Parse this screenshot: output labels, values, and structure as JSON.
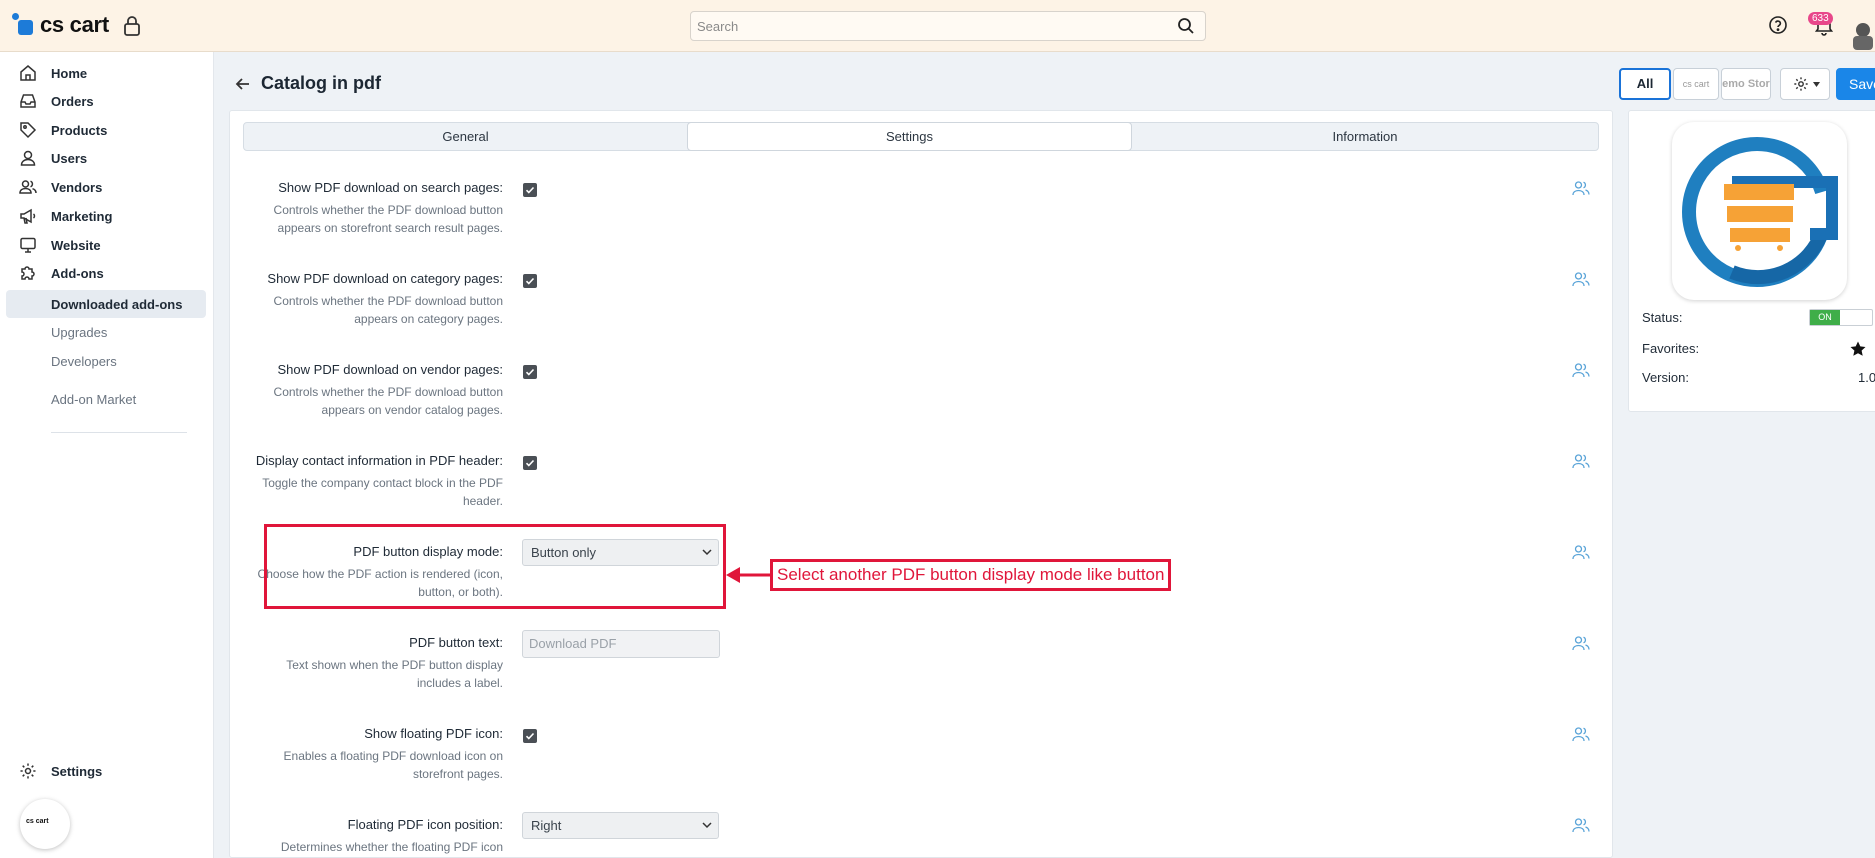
{
  "topbar": {
    "logo_text": "cs cart",
    "search_placeholder": "Search",
    "notification_count": "633"
  },
  "sidebar": {
    "items": [
      {
        "label": "Home"
      },
      {
        "label": "Orders"
      },
      {
        "label": "Products"
      },
      {
        "label": "Users"
      },
      {
        "label": "Vendors"
      },
      {
        "label": "Marketing"
      },
      {
        "label": "Website"
      },
      {
        "label": "Add-ons"
      }
    ],
    "subitems": [
      {
        "label": "Downloaded add-ons"
      },
      {
        "label": "Upgrades"
      },
      {
        "label": "Developers"
      },
      {
        "label": "Add-on Market"
      }
    ],
    "settings_label": "Settings",
    "store_bubble_text": "cs cart"
  },
  "header": {
    "title": "Catalog in pdf",
    "btn_all": "All",
    "btn_store1": "cs cart",
    "btn_store2": "emo Stor",
    "btn_save": "Save"
  },
  "tabs": [
    {
      "label": "General"
    },
    {
      "label": "Settings"
    },
    {
      "label": "Information"
    }
  ],
  "fields": [
    {
      "label": "Show PDF download on search pages:",
      "help": "Controls whether the PDF download button appears on storefront search result pages."
    },
    {
      "label": "Show PDF download on category pages:",
      "help": "Controls whether the PDF download button appears on category pages."
    },
    {
      "label": "Show PDF download on vendor pages:",
      "help": "Controls whether the PDF download button appears on vendor catalog pages."
    },
    {
      "label": "Display contact information in PDF header:",
      "help": "Toggle the company contact block in the PDF header."
    },
    {
      "label": "PDF button display mode:",
      "help": "Choose how the PDF action is rendered (icon, button, or both).",
      "value": "Button only"
    },
    {
      "label": "PDF button text:",
      "help": "Text shown when the PDF button display includes a label.",
      "placeholder": "Download PDF"
    },
    {
      "label": "Show floating PDF icon:",
      "help": "Enables a floating PDF download icon on storefront pages."
    },
    {
      "label": "Floating PDF icon position:",
      "help": "Determines whether the floating PDF icon",
      "value": "Right"
    }
  ],
  "annotation": {
    "text": "Select another PDF button display mode like button"
  },
  "addon_info": {
    "status_label": "Status:",
    "status_value": "ON",
    "favorites_label": "Favorites:",
    "version_label": "Version:",
    "version_value": "1.0"
  },
  "colors": {
    "accent": "#1a86e8",
    "annotation": "#e0163a",
    "status_on": "#3fae49",
    "badge": "#e8478a"
  }
}
